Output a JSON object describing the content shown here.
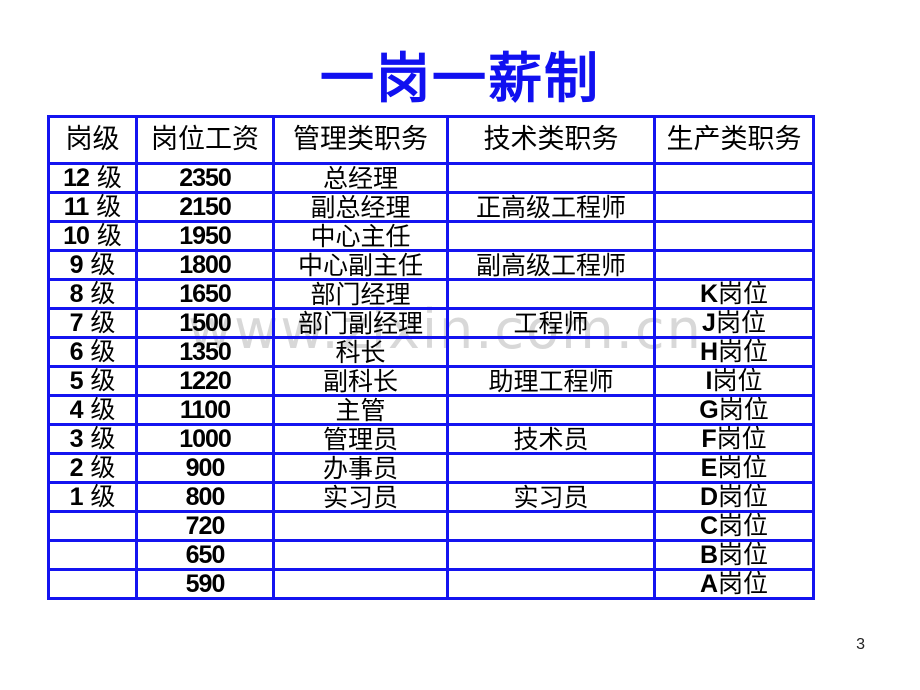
{
  "title": "一岗一薪制",
  "watermark": "www.zixin.com.cn",
  "page_number": "3",
  "colors": {
    "title": "#1010f0",
    "table_border": "#1414f0"
  },
  "table": {
    "headers": [
      "岗级",
      "岗位工资",
      "管理类职务",
      "技术类职务",
      "生产类职务"
    ],
    "rows": [
      {
        "level_num": "12",
        "level_unit": "级",
        "wage": "2350",
        "management": "总经理",
        "technical": "",
        "prod_letter": "",
        "prod_suffix": ""
      },
      {
        "level_num": "11",
        "level_unit": "级",
        "wage": "2150",
        "management": "副总经理",
        "technical": "正高级工程师",
        "prod_letter": "",
        "prod_suffix": ""
      },
      {
        "level_num": "10",
        "level_unit": "级",
        "wage": "1950",
        "management": "中心主任",
        "technical": "",
        "prod_letter": "",
        "prod_suffix": ""
      },
      {
        "level_num": "9",
        "level_unit": "级",
        "wage": "1800",
        "management": "中心副主任",
        "technical": "副高级工程师",
        "prod_letter": "",
        "prod_suffix": ""
      },
      {
        "level_num": "8",
        "level_unit": "级",
        "wage": "1650",
        "management": "部门经理",
        "technical": "",
        "prod_letter": "K",
        "prod_suffix": "岗位"
      },
      {
        "level_num": "7",
        "level_unit": "级",
        "wage": "1500",
        "management": "部门副经理",
        "technical": "工程师",
        "prod_letter": "J",
        "prod_suffix": "岗位"
      },
      {
        "level_num": "6",
        "level_unit": "级",
        "wage": "1350",
        "management": "科长",
        "technical": "",
        "prod_letter": "H",
        "prod_suffix": "岗位"
      },
      {
        "level_num": "5",
        "level_unit": "级",
        "wage": "1220",
        "management": "副科长",
        "technical": "助理工程师",
        "prod_letter": "I",
        "prod_suffix": "岗位"
      },
      {
        "level_num": "4",
        "level_unit": "级",
        "wage": "1100",
        "management": "主管",
        "technical": "",
        "prod_letter": "G",
        "prod_suffix": "岗位"
      },
      {
        "level_num": "3",
        "level_unit": "级",
        "wage": "1000",
        "management": "管理员",
        "technical": "技术员",
        "prod_letter": "F",
        "prod_suffix": "岗位"
      },
      {
        "level_num": "2",
        "level_unit": "级",
        "wage": "900",
        "management": "办事员",
        "technical": "",
        "prod_letter": "E",
        "prod_suffix": "岗位"
      },
      {
        "level_num": "1",
        "level_unit": "级",
        "wage": "800",
        "management": "实习员",
        "technical": "实习员",
        "prod_letter": "D",
        "prod_suffix": "岗位"
      },
      {
        "level_num": "",
        "level_unit": "",
        "wage": "720",
        "management": "",
        "technical": "",
        "prod_letter": "C",
        "prod_suffix": "岗位"
      },
      {
        "level_num": "",
        "level_unit": "",
        "wage": "650",
        "management": "",
        "technical": "",
        "prod_letter": "B",
        "prod_suffix": "岗位"
      },
      {
        "level_num": "",
        "level_unit": "",
        "wage": "590",
        "management": "",
        "technical": "",
        "prod_letter": "A",
        "prod_suffix": "岗位"
      }
    ]
  }
}
